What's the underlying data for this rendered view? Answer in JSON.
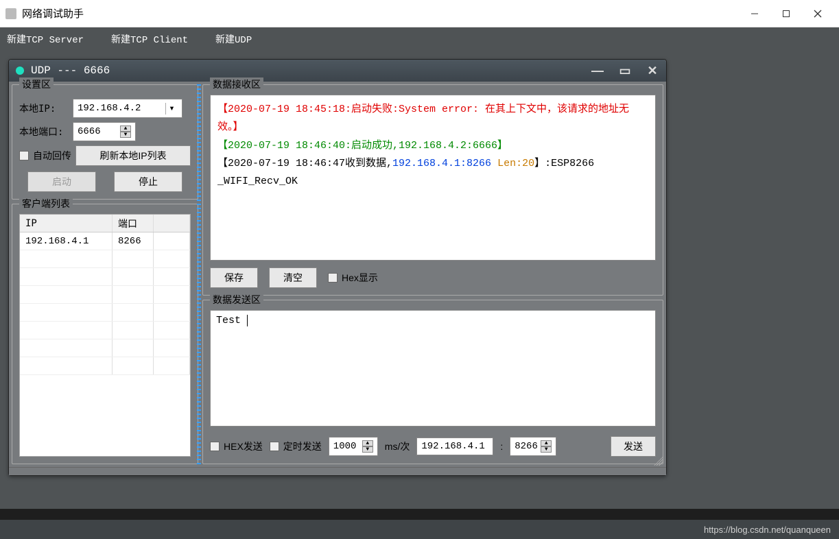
{
  "outer": {
    "title": "网络调试助手"
  },
  "menu": {
    "tcp_server": "新建TCP Server",
    "tcp_client": "新建TCP Client",
    "udp": "新建UDP"
  },
  "child": {
    "title": "UDP --- 6666"
  },
  "settings": {
    "title": "设置区",
    "local_ip_label": "本地IP:",
    "local_ip_value": "192.168.4.2",
    "local_port_label": "本地端口:",
    "local_port_value": "6666",
    "auto_reply_label": "自动回传",
    "refresh_ip_label": "刷新本地IP列表",
    "start_label": "启动",
    "stop_label": "停止"
  },
  "clients": {
    "title": "客户端列表",
    "col_ip": "IP",
    "col_port": "端口",
    "rows": [
      {
        "ip": "192.168.4.1",
        "port": "8266"
      }
    ]
  },
  "recv": {
    "title": "数据接收区",
    "line1": "【2020-07-19 18:45:18:启动失败:System error: 在其上下文中，该请求的地址无效。】",
    "line2": "【2020-07-19 18:46:40:启动成功,192.168.4.2:6666】",
    "line3a": "【2020-07-19 18:46:47收到数据,",
    "line3b": "192.168.4.1:8266",
    "line3c": " Len:20",
    "line3d": "】:ESP8266",
    "line4": "_WIFI_Recv_OK",
    "save_label": "保存",
    "clear_label": "清空",
    "hex_display_label": "Hex显示"
  },
  "send": {
    "title": "数据发送区",
    "text_value": "Test",
    "hex_send_label": "HEX发送",
    "timed_send_label": "定时发送",
    "interval_value": "1000",
    "interval_unit": "ms/次",
    "target_ip": "192.168.4.1",
    "target_port": "8266",
    "port_separator": ":",
    "send_label": "发送"
  },
  "footer": {
    "watermark": "https://blog.csdn.net/quanqueen"
  }
}
